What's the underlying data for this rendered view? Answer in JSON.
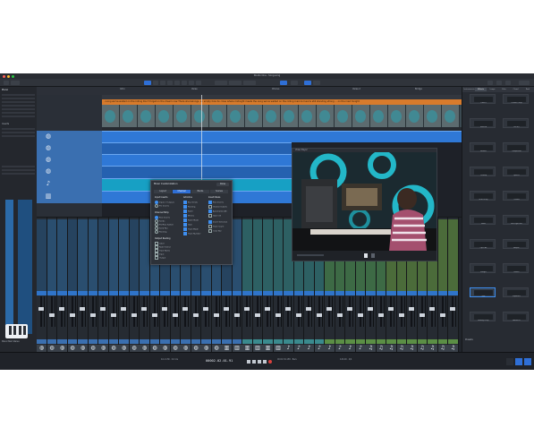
{
  "window": {
    "title": "Studio One - Song.song",
    "accent": "#2f6fd6"
  },
  "inspector": {
    "track_name": "Piano",
    "section_label": "Inserts",
    "channel_label": "Piano Main Stereo"
  },
  "arrangement": {
    "ruler_marks": [
      "Intro",
      "Verse",
      "Chorus",
      "Verse 2",
      "Bridge"
    ],
    "lyrics": "...Long we've waited on the rolling   Don't forget on the dream now   There she belongs, an empty hole   So close where midnight meets the   Long we've waited on the rolling road   And we're still standing strong ... on the road tonight"
  },
  "dialog": {
    "title": "Mixer Customization",
    "done_label": "Done",
    "tabs": [
      "Layout",
      "Channel",
      "Banks",
      "Scenes"
    ],
    "columns": [
      {
        "header": "Input Inserts",
        "items": [
          "Inputs / Outputs",
          "Pre Inserts"
        ]
      },
      {
        "header": "Channel Strip",
        "items": [
          "Post Inserts",
          "Sends",
          "Pre/Post Switch",
          "Send Pan",
          "Panning"
        ]
      },
      {
        "header": "Output Routing",
        "items": [
          "Label",
          "Fader Select",
          "Track Notes",
          "Input",
          "Output"
        ]
      }
    ],
    "col2_header": "Add-Ons",
    "col2_items": [
      "Bus Sends",
      "Panning",
      "Fader",
      "Meters",
      "Fader Mode",
      "Gain",
      "Track Mode",
      "Track Number"
    ],
    "col3_header": "Insert Rows",
    "col3_items": [
      "Post Inserts",
      "Channel Labels",
      "Automation Alt",
      "Gain Ctrl",
      "Insert Selection",
      "Track Count",
      "Color Bar"
    ]
  },
  "video": {
    "title": "Video Player"
  },
  "browser": {
    "tabs": [
      "Instruments",
      "Effects",
      "Loops",
      "Files",
      "Cloud",
      "Pool"
    ],
    "items": [
      {
        "label": "Limiter"
      },
      {
        "label": "Channel Strip"
      },
      {
        "label": "Mixverb"
      },
      {
        "label": "Pro EQ"
      },
      {
        "label": "Vocoder"
      },
      {
        "label": "Compressor"
      },
      {
        "label": "Tricomp"
      },
      {
        "label": "Splitter"
      },
      {
        "label": "Beat Delay"
      },
      {
        "label": "Chorus"
      },
      {
        "label": "Rotor"
      },
      {
        "label": "Red Light Dist"
      },
      {
        "label": "Open Air"
      },
      {
        "label": "Ampire"
      },
      {
        "label": "Flanger"
      },
      {
        "label": "Phaser"
      },
      {
        "label": "Gate"
      },
      {
        "label": "Expander"
      },
      {
        "label": "Analog Delay"
      },
      {
        "label": "Autofilter"
      }
    ],
    "footer": "Presets"
  },
  "transport": {
    "time": "00002.02.01.91",
    "left_info": "44.1 kHz · 0.0 ms",
    "right_info": "00:01:34.158 · Bars",
    "tempo_info": "120.00 · 4/4"
  }
}
